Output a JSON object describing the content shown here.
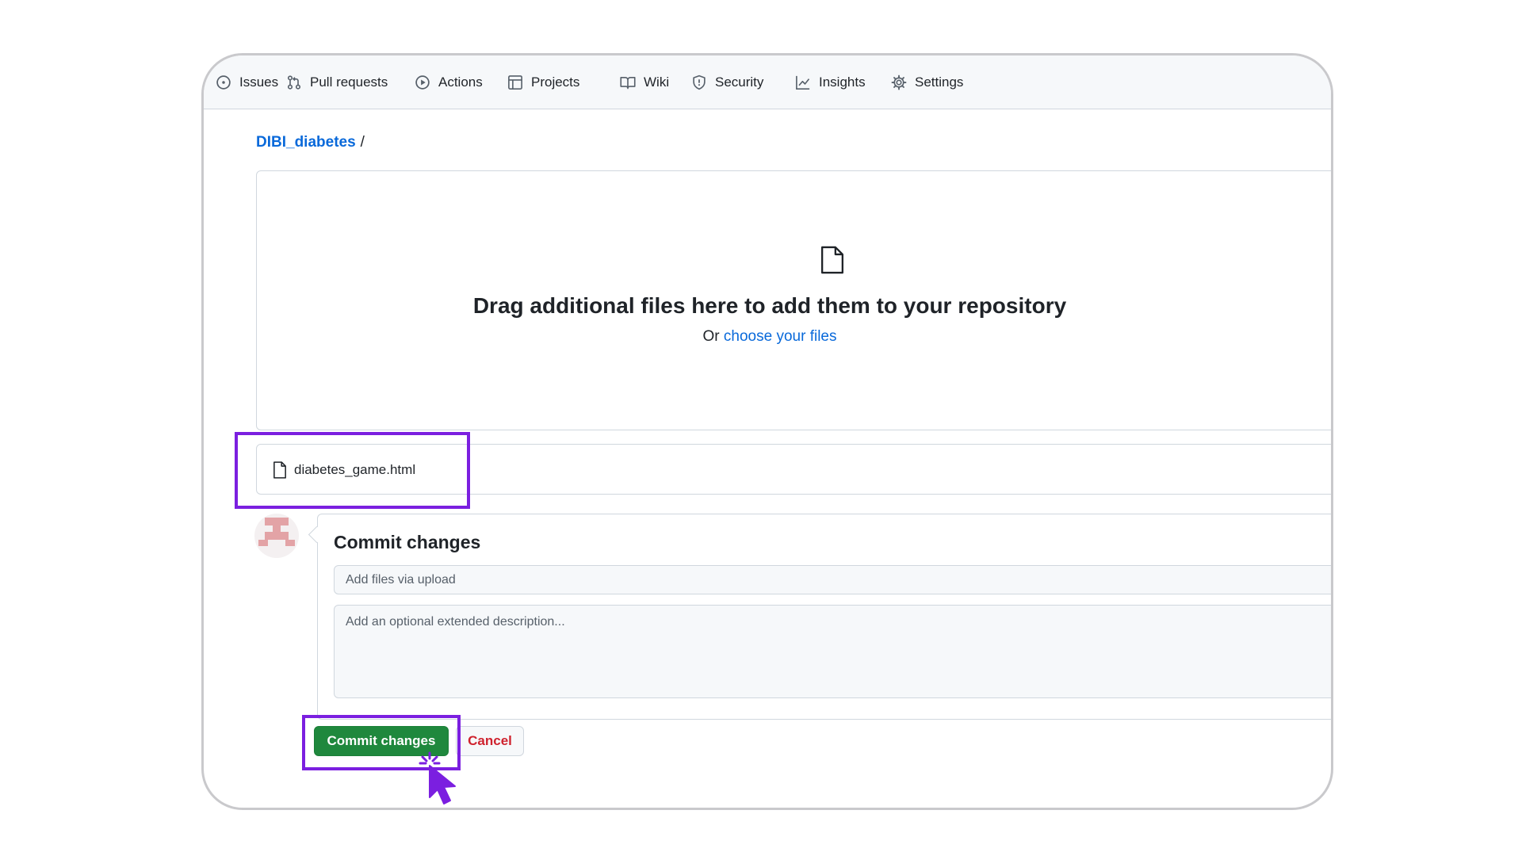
{
  "nav": {
    "items": [
      {
        "label": "Issues",
        "icon": "issue-opened-icon"
      },
      {
        "label": "Pull requests",
        "icon": "git-pull-request-icon"
      },
      {
        "label": "Actions",
        "icon": "play-icon"
      },
      {
        "label": "Projects",
        "icon": "table-icon"
      },
      {
        "label": "Wiki",
        "icon": "book-icon"
      },
      {
        "label": "Security",
        "icon": "shield-icon"
      },
      {
        "label": "Insights",
        "icon": "graph-icon"
      },
      {
        "label": "Settings",
        "icon": "gear-icon"
      }
    ]
  },
  "breadcrumb": {
    "repo": "DIBI_diabetes",
    "separator": "/"
  },
  "dropzone": {
    "title": "Drag additional files here to add them to your repository",
    "prefix": "Or",
    "link": "choose your files"
  },
  "uploaded_file": {
    "name": "diabetes_game.html"
  },
  "commit": {
    "title": "Commit changes",
    "summary_placeholder": "Add files via upload",
    "description_placeholder": "Add an optional extended description...",
    "commit_button": "Commit changes",
    "cancel_button": "Cancel"
  },
  "colors": {
    "highlight": "#7b1fe0",
    "commit_green": "#1f883d",
    "link_blue": "#0969da",
    "cancel_red": "#cf222e"
  }
}
